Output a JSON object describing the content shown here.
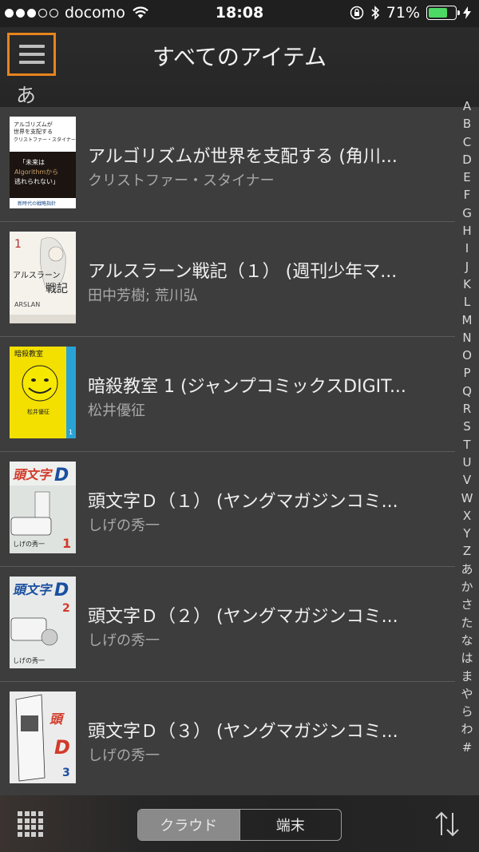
{
  "status": {
    "carrier": "docomo",
    "time": "18:08",
    "battery": "71%",
    "battery_level": 0.71,
    "signal_bars": 3,
    "signal_total": 5
  },
  "header": {
    "title": "すべてのアイテム",
    "section": "あ"
  },
  "items": [
    {
      "title": "アルゴリズムが世界を支配する (角川...",
      "author": "クリストファー・スタイナー",
      "cover": "algorithm-book-cover"
    },
    {
      "title": "アルスラーン戦記（１） (週刊少年マ...",
      "author": "田中芳樹; 荒川弘",
      "cover": "arslan-cover"
    },
    {
      "title": "暗殺教室 1 (ジャンプコミックスDIGIT...",
      "author": "松井優征",
      "cover": "assassination-classroom-cover"
    },
    {
      "title": "頭文字Ｄ（１） (ヤングマガジンコミ...",
      "author": "しげの秀一",
      "cover": "initial-d-1-cover"
    },
    {
      "title": "頭文字Ｄ（２） (ヤングマガジンコミ...",
      "author": "しげの秀一",
      "cover": "initial-d-2-cover"
    },
    {
      "title": "頭文字Ｄ（３） (ヤングマガジンコミ...",
      "author": "しげの秀一",
      "cover": "initial-d-3-cover"
    }
  ],
  "index_letters": [
    "A",
    "B",
    "C",
    "D",
    "E",
    "F",
    "G",
    "H",
    "I",
    "J",
    "K",
    "L",
    "M",
    "N",
    "O",
    "P",
    "Q",
    "R",
    "S",
    "T",
    "U",
    "V",
    "W",
    "X",
    "Y",
    "Z",
    "あ",
    "か",
    "さ",
    "た",
    "な",
    "は",
    "ま",
    "や",
    "ら",
    "わ",
    "#"
  ],
  "bottom": {
    "cloud_label": "クラウド",
    "device_label": "端末"
  },
  "colors": {
    "accent": "#e8841e",
    "battery": "#4cd964",
    "list_bg": "#3d3d3d"
  }
}
